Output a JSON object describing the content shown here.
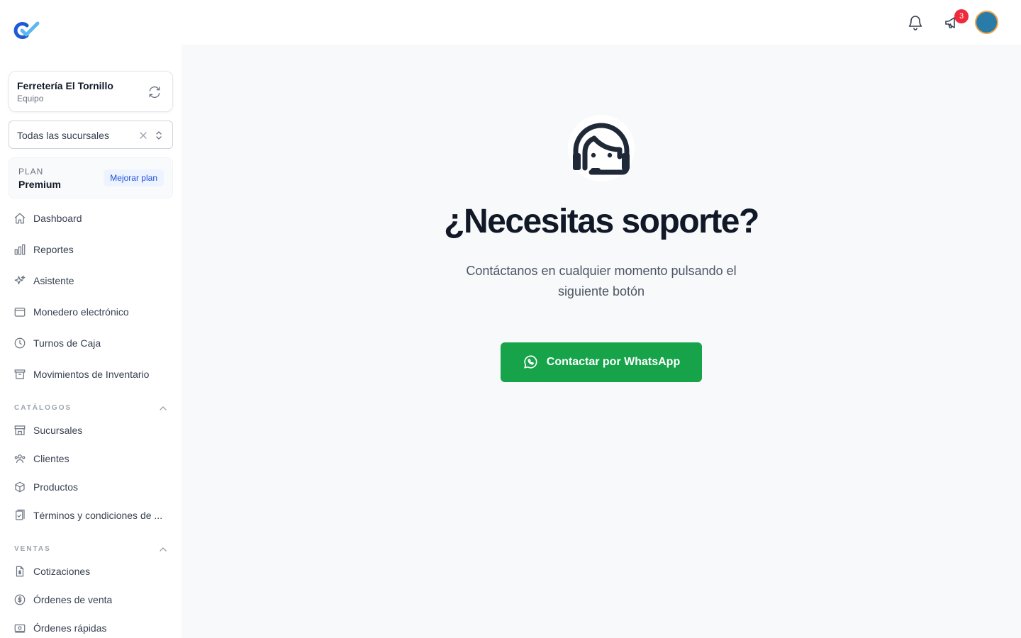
{
  "sidebar": {
    "team": {
      "name": "Ferretería El Tornillo",
      "role": "Equipo"
    },
    "branch_select": {
      "value": "Todas las sucursales"
    },
    "plan": {
      "label": "PLAN",
      "value": "Premium",
      "upgrade_label": "Mejorar plan"
    },
    "nav": [
      {
        "label": "Dashboard",
        "icon": "home-icon"
      },
      {
        "label": "Reportes",
        "icon": "bar-chart-icon"
      },
      {
        "label": "Asistente",
        "icon": "sparkles-icon"
      },
      {
        "label": "Monedero electrónico",
        "icon": "wallet-icon"
      },
      {
        "label": "Turnos de Caja",
        "icon": "clock-icon"
      },
      {
        "label": "Movimientos de Inventario",
        "icon": "archive-box-icon"
      }
    ],
    "sections": [
      {
        "title": "CATÁLOGOS",
        "items": [
          {
            "label": "Sucursales",
            "icon": "storefront-icon"
          },
          {
            "label": "Clientes",
            "icon": "users-icon"
          },
          {
            "label": "Productos",
            "icon": "cube-icon"
          },
          {
            "label": "Términos y condiciones de ...",
            "icon": "document-check-icon"
          }
        ]
      },
      {
        "title": "VENTAS",
        "items": [
          {
            "label": "Cotizaciones",
            "icon": "document-dollar-icon"
          },
          {
            "label": "Órdenes de venta",
            "icon": "dollar-circle-icon"
          },
          {
            "label": "Órdenes rápidas",
            "icon": "cash-icon"
          }
        ]
      }
    ]
  },
  "header": {
    "notification_count": "3"
  },
  "main": {
    "title": "¿Necesitas soporte?",
    "subtitle": "Contáctanos en cualquier momento pulsando el siguiente botón",
    "button_label": "Contactar por WhatsApp"
  },
  "colors": {
    "whatsapp_green": "#16a34a",
    "badge_red": "#ef2b3b",
    "brand_blue": "#1e5ad6",
    "brand_light": "#5eb8f0"
  }
}
